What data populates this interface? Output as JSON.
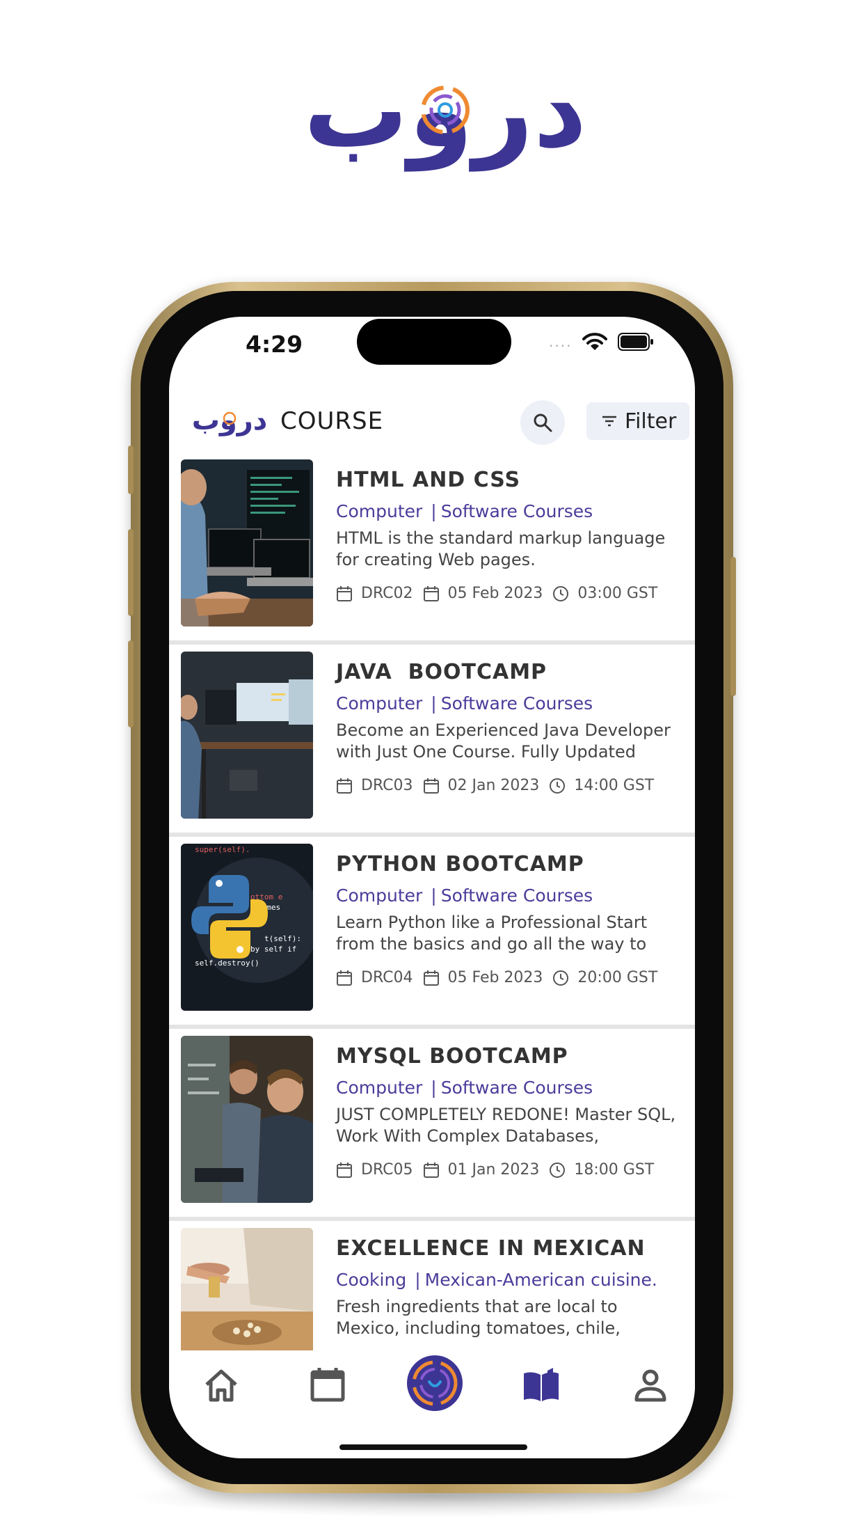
{
  "brand": {
    "logo_text": "دروب",
    "primary_color": "#3d3593",
    "accent_color": "#f08a32"
  },
  "status_bar": {
    "time": "4:29",
    "signal_dots": "....",
    "icons": [
      "wifi-icon",
      "battery-icon"
    ]
  },
  "header": {
    "title": "COURSE",
    "search_icon": "search-icon",
    "filter_label": "Filter",
    "filter_icon": "filter-icon"
  },
  "courses": [
    {
      "title": "HTML AND CSS",
      "category": "Computer",
      "subcategory": "Software Courses",
      "description": "HTML is the standard markup language for creating Web pages.",
      "code": "DRC02",
      "date": "05 Feb 2023",
      "time": "03:00 GST"
    },
    {
      "title": "JAVA  BOOTCAMP",
      "category": "Computer",
      "subcategory": "Software Courses",
      "description": "Become an Experienced Java Developer with Just One Course. Fully Updated",
      "code": "DRC03",
      "date": "02 Jan 2023",
      "time": "14:00 GST"
    },
    {
      "title": "PYTHON BOOTCAMP",
      "category": "Computer",
      "subcategory": "Software Courses",
      "description": "Learn Python like a Professional Start from the basics and go all the way to",
      "code": "DRC04",
      "date": "05 Feb 2023",
      "time": "20:00 GST"
    },
    {
      "title": "MYSQL BOOTCAMP",
      "category": "Computer",
      "subcategory": "Software Courses",
      "description": "JUST COMPLETELY REDONE! Master SQL, Work With Complex Databases,",
      "code": "DRC05",
      "date": "01 Jan 2023",
      "time": "18:00 GST"
    },
    {
      "title": "EXCELLENCE IN MEXICAN",
      "category": "Cooking",
      "subcategory": "Mexican-American cuisine.",
      "description": "Fresh ingredients that are local to Mexico, including tomatoes, chile,",
      "code": "",
      "date": "",
      "time": ""
    }
  ],
  "bottom_nav": [
    {
      "name": "home",
      "icon": "home-icon"
    },
    {
      "name": "calendar",
      "icon": "calendar-icon"
    },
    {
      "name": "center",
      "icon": "brand-center-icon"
    },
    {
      "name": "courses",
      "icon": "book-icon"
    },
    {
      "name": "profile",
      "icon": "person-icon"
    }
  ]
}
